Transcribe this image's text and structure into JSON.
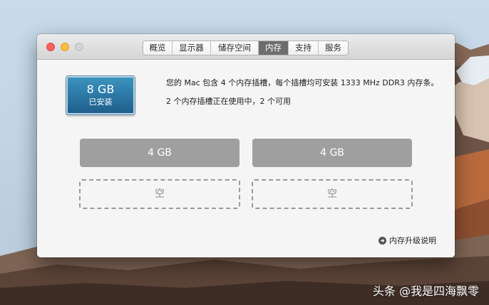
{
  "tabs": [
    {
      "label": "概览",
      "active": false
    },
    {
      "label": "显示器",
      "active": false
    },
    {
      "label": "储存空间",
      "active": false
    },
    {
      "label": "内存",
      "active": true
    },
    {
      "label": "支持",
      "active": false
    },
    {
      "label": "服务",
      "active": false
    }
  ],
  "memory": {
    "total": "8 GB",
    "status": "已安装",
    "description": "您的 Mac 包含 4 个内存插槽，每个插槽均可安装 1333 MHz DDR3 内存条。",
    "slot_usage": "2 个内存插槽正在使用中，2 个可用",
    "slots": [
      {
        "label": "4 GB",
        "state": "filled"
      },
      {
        "label": "4 GB",
        "state": "filled"
      },
      {
        "label": "空",
        "state": "empty"
      },
      {
        "label": "空",
        "state": "empty"
      }
    ],
    "upgrade_link": "内存升级说明"
  },
  "watermark": "头条 @我是四海飘零",
  "colors": {
    "close": "#fc605c",
    "minimize": "#fdbc40",
    "zoom": "#d3d3d3",
    "active_tab": "#6d6d6d",
    "memory_icon": "#2c78a6",
    "filled_slot": "#9f9f9f"
  },
  "icons": {
    "upgrade_link": "arrow-right-circle-icon"
  }
}
